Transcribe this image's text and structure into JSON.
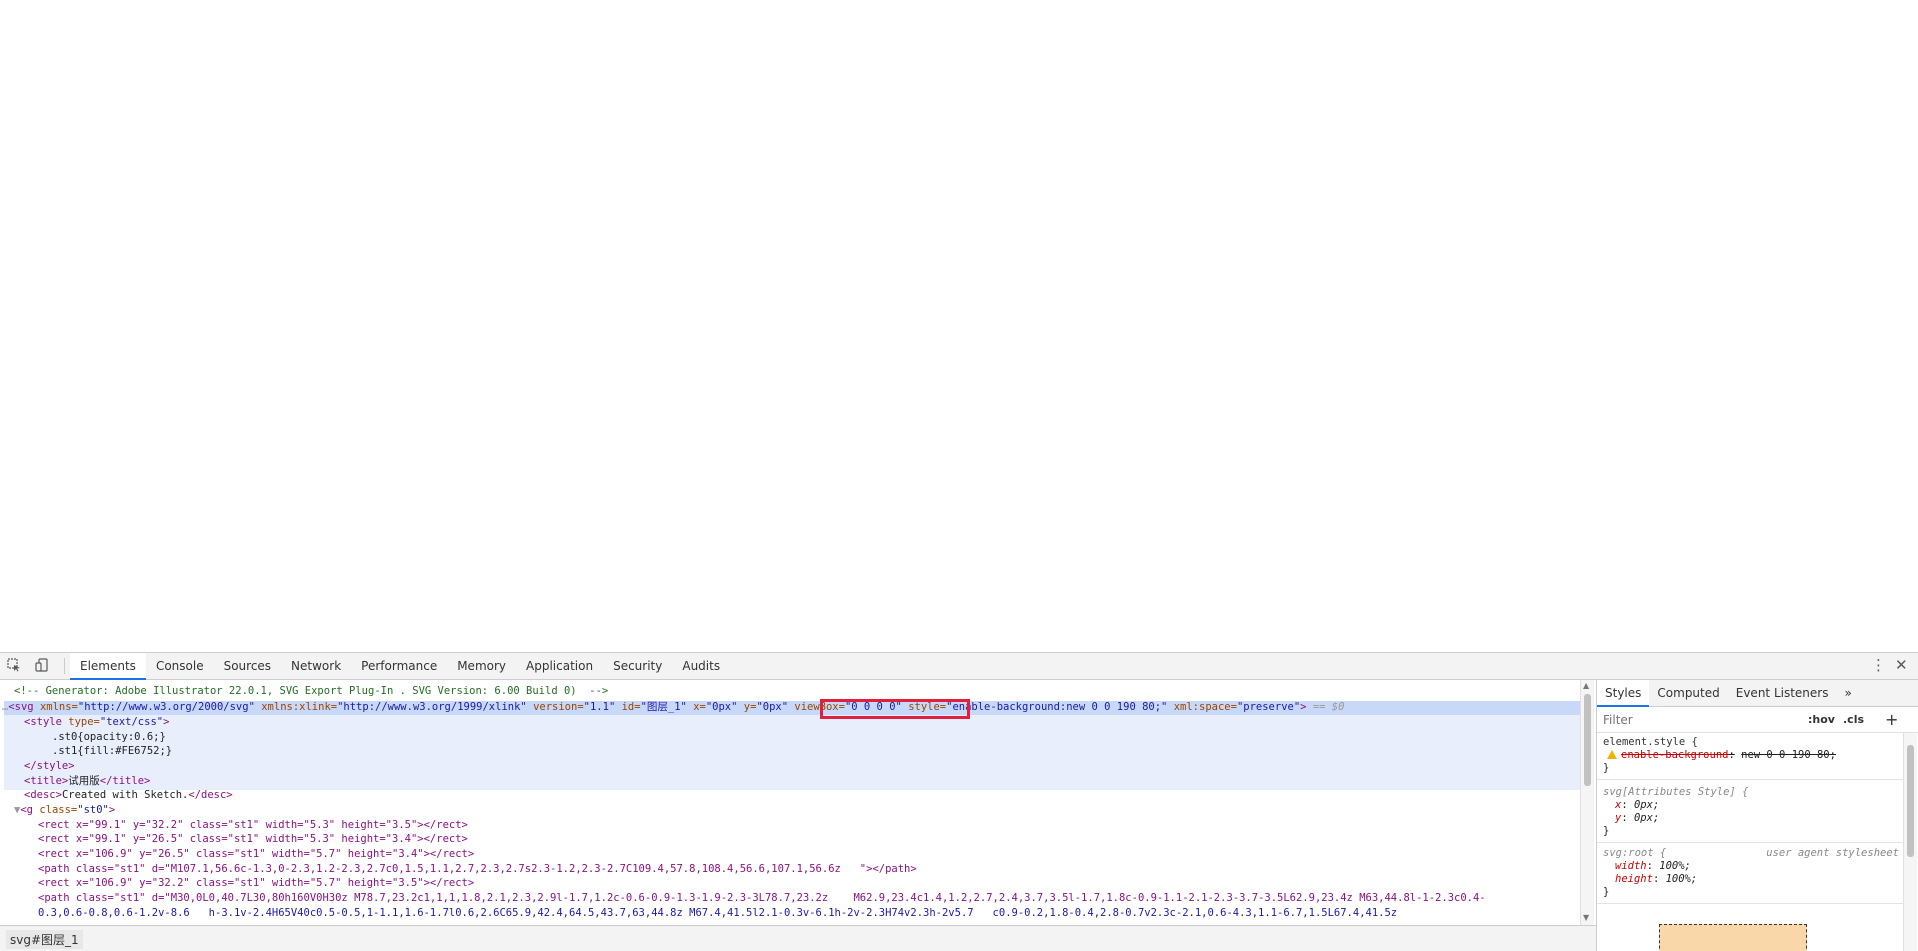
{
  "devtools": {
    "toolbar": {
      "inspect_icon": "inspect-element-icon",
      "device_icon": "device-toolbar-icon",
      "tabs": [
        {
          "label": "Elements",
          "active": true
        },
        {
          "label": "Console"
        },
        {
          "label": "Sources"
        },
        {
          "label": "Network"
        },
        {
          "label": "Performance"
        },
        {
          "label": "Memory"
        },
        {
          "label": "Application"
        },
        {
          "label": "Security"
        },
        {
          "label": "Audits"
        }
      ],
      "menu_icon": "kebab-menu-icon",
      "close_icon": "close-icon"
    },
    "elements": {
      "line0": "<!-- Generator: Adobe Illustrator 22.0.1, SVG Export Plug-In . SVG Version: 6.00 Build 0)  -->",
      "line1": {
        "dots": "…",
        "tag_open": "<svg",
        "a_xmlns": "xmlns=",
        "v_xmlns": "\"http://www.w3.org/2000/svg\"",
        "a_xlink": "xmlns:xlink=",
        "v_xlink": "\"http://www.w3.org/1999/xlink\"",
        "a_version": "version=",
        "v_version": "\"1.1\"",
        "a_id": "id=",
        "v_id": "\"图层_1\"",
        "a_x": "x=",
        "v_x": "\"0px\"",
        "a_y": "y=",
        "v_y": "\"0px\"",
        "a_viewbox": "viewBox=",
        "v_viewbox": "\"0 0 0 0\"",
        "a_style": "style=",
        "v_style": "\"enable-background:new 0 0 190 80;\"",
        "a_xmlspace": "xml:space=",
        "v_xmlspace": "\"preserve\"",
        "tag_close": ">",
        "eq": "== $0"
      },
      "line2": {
        "tag": "<style",
        "attr": "type=",
        "val": "\"text/css\"",
        "close": ">"
      },
      "line3": ".st0{opacity:0.6;}",
      "line4": ".st1{fill:#FE6752;}",
      "line5": "</style>",
      "line6": {
        "open": "<title>",
        "text": "试用版",
        "close": "</title>"
      },
      "line7": {
        "open": "<desc>",
        "text": "Created with Sketch.",
        "close": "</desc>"
      },
      "line8": {
        "tag": "<g",
        "attr": "class=",
        "val": "\"st0\"",
        "close": ">"
      },
      "line9": "<rect x=\"99.1\" y=\"32.2\" class=\"st1\" width=\"5.3\" height=\"3.5\"></rect>",
      "line10": "<rect x=\"99.1\" y=\"26.5\" class=\"st1\" width=\"5.3\" height=\"3.4\"></rect>",
      "line11": "<rect x=\"106.9\" y=\"26.5\" class=\"st1\" width=\"5.7\" height=\"3.4\"></rect>",
      "line12": "<path class=\"st1\" d=\"M107.1,56.6c-1.3,0-2.3,1.2-2.3,2.7c0,1.5,1.1,2.7,2.3,2.7s2.3-1.2,2.3-2.7C109.4,57.8,108.4,56.6,107.1,56.6z   \"></path>",
      "line13": "<rect x=\"106.9\" y=\"32.2\" class=\"st1\" width=\"5.7\" height=\"3.5\"></rect>",
      "line14": "<path class=\"st1\" d=\"M30,0L0,40.7L30,80h160V0H30z M78.7,23.2c1,1,1,1.8,2.1,2.3,2.9l-1.7,1.2c-0.6-0.9-1.3-1.9-2.3-3L78.7,23.2z    M62.9,23.4c1.4,1.2,2.7,2.4,3.7,3.5l-1.7,1.8c-0.9-1.1-2.1-2.3-3.7-3.5L62.9,23.4z M63,44.8l-1-2.3c0.4-",
      "line15": "0.3,0.6-0.8,0.6-1.2v-8.6   h-3.1v-2.4H65V40c0.5-0.5,1-1.1,1.6-1.7l0.6,2.6C65.9,42.4,64.5,43.7,63,44.8z M67.4,41.5l2.1-0.3v-6.1h-2v-2.3H74v2.3h-2v5.7   c0.9-0.2,1.8-0.4,2.8-0.7v2.3c-2.1,0.6-4.3,1.1-6.7,1.5L67.4,41.5z"
    },
    "breadcrumb": "svg#图层_1",
    "styles": {
      "tabs": [
        "Styles",
        "Computed",
        "Event Listeners"
      ],
      "more_icon": "chevron-double-right-icon",
      "filter_placeholder": "Filter",
      "hov": ":hov",
      ".cls": ".cls",
      "add_icon": "plus-icon",
      "rule1": {
        "selector": "element.style {",
        "prop": "enable-background",
        "value": "new 0 0 190 80;",
        "close": "}"
      },
      "rule2": {
        "selector": "svg[Attributes Style] {",
        "p1": "x",
        "v1": "0px;",
        "p2": "y",
        "v2": "0px;",
        "close": "}"
      },
      "rule3": {
        "selector": "svg:root {",
        "source": "user agent stylesheet",
        "p1": "width",
        "v1": "100%;",
        "p2": "height",
        "v2": "100%;",
        "close": "}"
      },
      "colon": ":"
    }
  }
}
